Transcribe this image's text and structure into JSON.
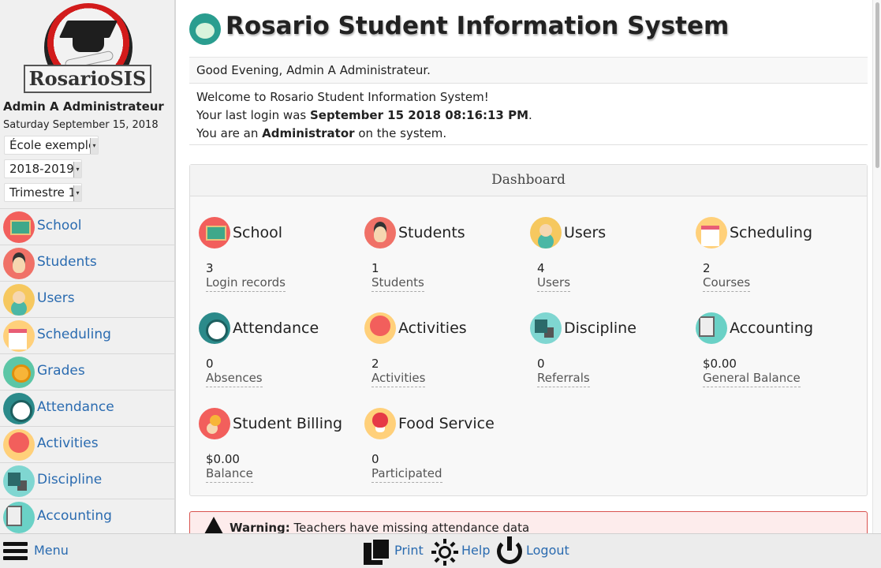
{
  "sidebar": {
    "logo_text": "RosarioSIS",
    "user_name": "Admin A Administrateur",
    "date": "Saturday September 15, 2018",
    "school_select": "École exemple",
    "year_select": "2018-2019",
    "period_select": "Trimestre 1",
    "menu": [
      {
        "label": "School",
        "icon": "school-icon"
      },
      {
        "label": "Students",
        "icon": "students-icon"
      },
      {
        "label": "Users",
        "icon": "users-icon"
      },
      {
        "label": "Scheduling",
        "icon": "scheduling-icon"
      },
      {
        "label": "Grades",
        "icon": "grades-icon"
      },
      {
        "label": "Attendance",
        "icon": "attendance-icon"
      },
      {
        "label": "Activities",
        "icon": "activities-icon"
      },
      {
        "label": "Discipline",
        "icon": "discipline-icon"
      },
      {
        "label": "Accounting",
        "icon": "accounting-icon"
      }
    ]
  },
  "header": {
    "title": "Rosario Student Information System",
    "icon": "globe-icon"
  },
  "greeting": "Good Evening, Admin A Administrateur.",
  "welcome": {
    "line1": "Welcome to Rosario Student Information System!",
    "line2_prefix": "Your last login was ",
    "last_login": "September 15 2018 08:16:13 PM",
    "line2_suffix": ".",
    "line3_prefix": "You are an ",
    "role": "Administrator",
    "line3_suffix": " on the system."
  },
  "dashboard": {
    "title": "Dashboard",
    "cards": [
      {
        "title": "School",
        "value": "3",
        "label": "Login records",
        "icon": "school-icon"
      },
      {
        "title": "Students",
        "value": "1",
        "label": "Students",
        "icon": "students-icon"
      },
      {
        "title": "Users",
        "value": "4",
        "label": "Users",
        "icon": "users-icon"
      },
      {
        "title": "Scheduling",
        "value": "2",
        "label": "Courses",
        "icon": "scheduling-icon"
      },
      {
        "title": "Attendance",
        "value": "0",
        "label": "Absences",
        "icon": "attendance-icon"
      },
      {
        "title": "Activities",
        "value": "2",
        "label": "Activities",
        "icon": "activities-icon"
      },
      {
        "title": "Discipline",
        "value": "0",
        "label": "Referrals",
        "icon": "discipline-icon"
      },
      {
        "title": "Accounting",
        "value": "$0.00",
        "label": "General Balance",
        "icon": "accounting-icon"
      },
      {
        "title": "Student Billing",
        "value": "$0.00",
        "label": "Balance",
        "icon": "student-billing-icon"
      },
      {
        "title": "Food Service",
        "value": "0",
        "label": "Participated",
        "icon": "food-service-icon"
      }
    ]
  },
  "warning": {
    "strong": "Warning:",
    "text": " Teachers have missing attendance data"
  },
  "footer": {
    "menu_label": "Menu",
    "print_label": "Print",
    "help_label": "Help",
    "logout_label": "Logout"
  },
  "colors": {
    "link": "#2a6bb0",
    "sidebar_bg": "#f0f0f0",
    "warning_bg": "#fdecec",
    "warning_border": "#d9534f"
  }
}
